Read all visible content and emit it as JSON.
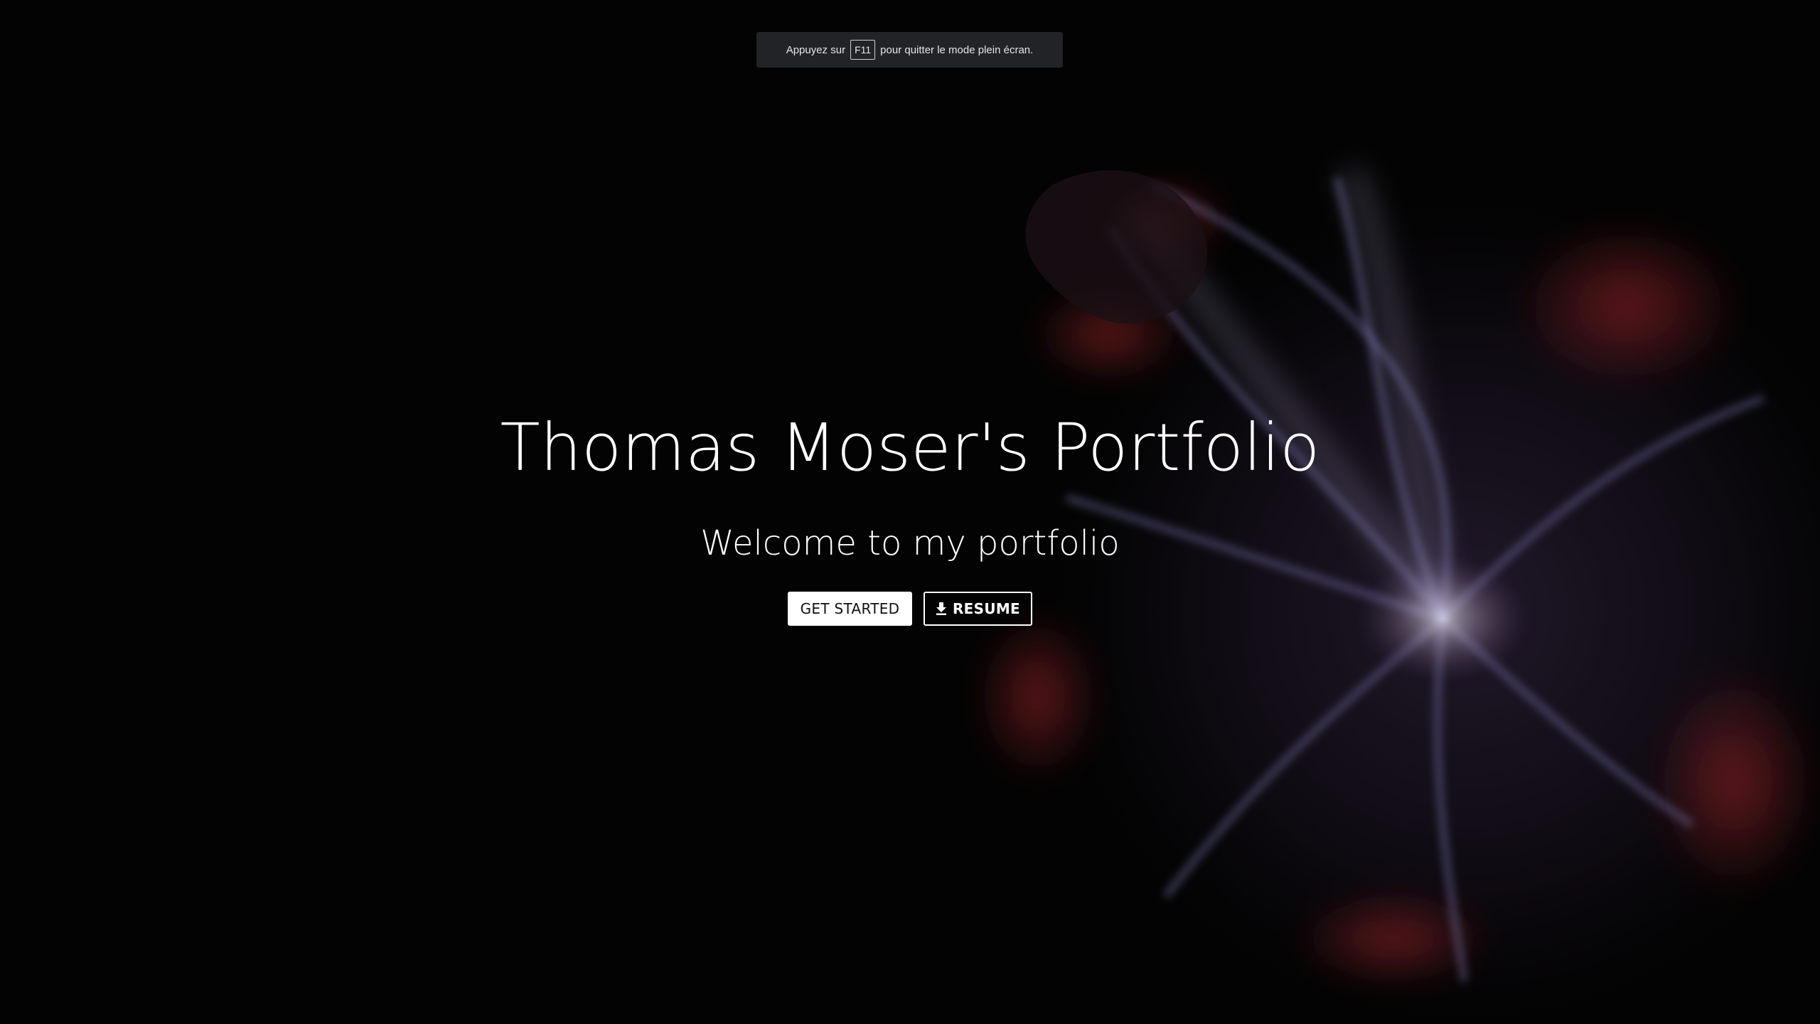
{
  "fullscreen_notice": {
    "prefix": "Appuyez sur",
    "key": "F11",
    "suffix": "pour quitter le mode plein écran."
  },
  "hero": {
    "title": "Thomas Moser's Portfolio",
    "subtitle": "Welcome to my portfolio"
  },
  "actions": {
    "get_started_label": "GET STARTED",
    "resume_label": "RESUME",
    "resume_icon": "download-icon"
  },
  "colors": {
    "background": "#030303",
    "text": "#ffffff",
    "banner": "#222327",
    "glow_blue": "#8c8cff",
    "glow_red": "#b4282d"
  }
}
